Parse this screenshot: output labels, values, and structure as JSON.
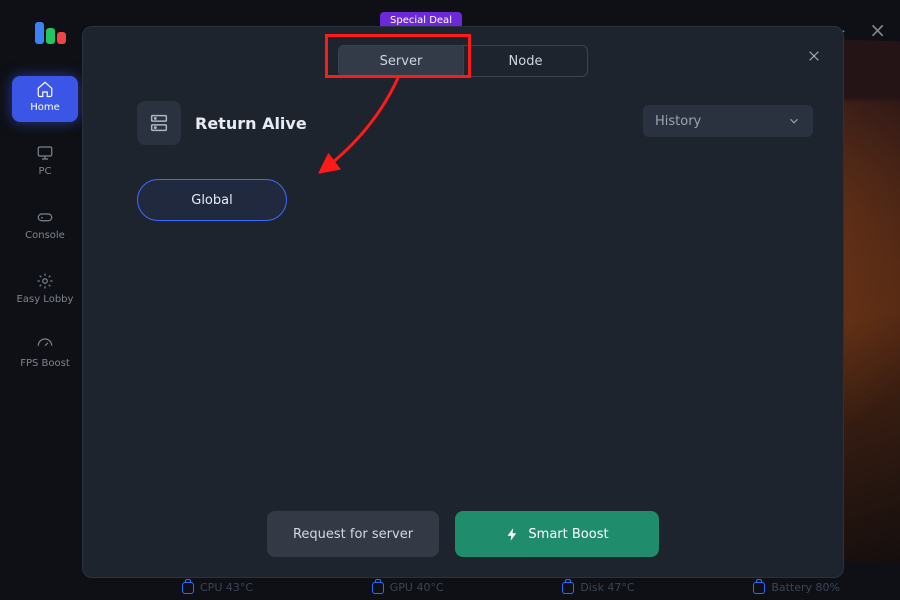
{
  "topBadge": "Special Deal",
  "sidebar": {
    "items": [
      {
        "label": "Home"
      },
      {
        "label": "PC"
      },
      {
        "label": "Console"
      },
      {
        "label": "Easy Lobby"
      },
      {
        "label": "FPS Boost"
      }
    ]
  },
  "modal": {
    "tabs": [
      {
        "label": "Server"
      },
      {
        "label": "Node"
      }
    ],
    "game_title": "Return Alive",
    "history_label": "History",
    "server_options": [
      {
        "label": "Global"
      }
    ],
    "footer": {
      "request_label": "Request for server",
      "boost_label": "Smart Boost"
    }
  },
  "stats": [
    {
      "label": "CPU 43°C"
    },
    {
      "label": "GPU 40°C"
    },
    {
      "label": "Disk 47°C"
    },
    {
      "label": "Battery 80%"
    }
  ]
}
